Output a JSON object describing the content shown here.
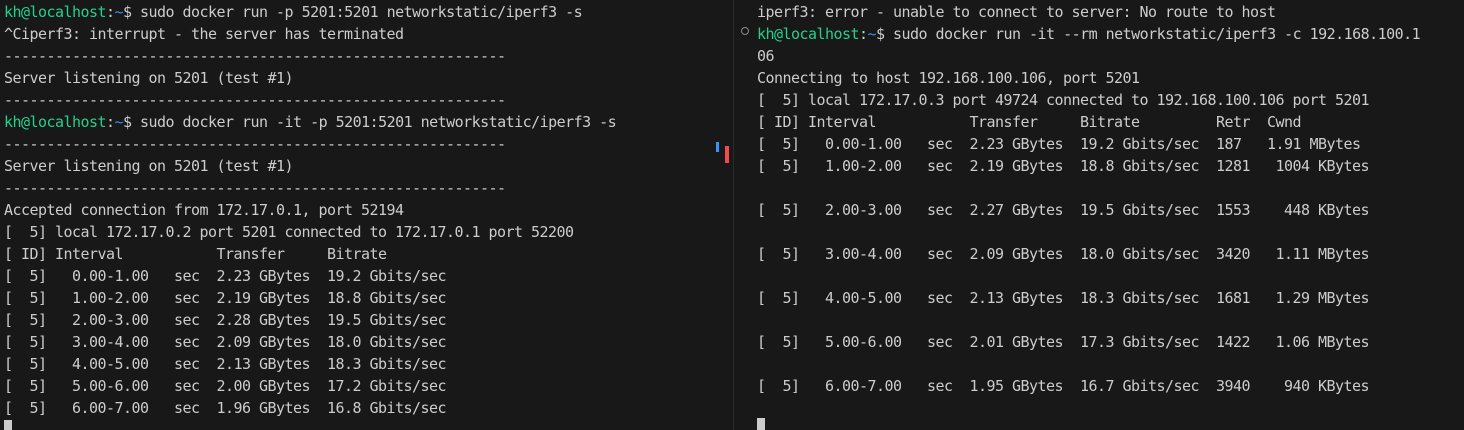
{
  "left_terminal": {
    "lines": [
      {
        "user": "kh@localhost",
        "sep": ":",
        "path": "~",
        "rest": "$ sudo docker run -p 5201:5201 networkstatic/iperf3 -s"
      },
      {
        "text": "^Ciperf3: interrupt - the server has terminated"
      },
      {
        "text": "-----------------------------------------------------------"
      },
      {
        "text": "Server listening on 5201 (test #1)"
      },
      {
        "text": "-----------------------------------------------------------"
      },
      {
        "user": "kh@localhost",
        "sep": ":",
        "path": "~",
        "rest": "$ sudo docker run -it -p 5201:5201 networkstatic/iperf3 -s"
      },
      {
        "text": "-----------------------------------------------------------"
      },
      {
        "text": "Server listening on 5201 (test #1)"
      },
      {
        "text": "-----------------------------------------------------------"
      },
      {
        "text": "Accepted connection from 172.17.0.1, port 52194"
      },
      {
        "text": "[  5] local 172.17.0.2 port 5201 connected to 172.17.0.1 port 52200"
      },
      {
        "text": "[ ID] Interval           Transfer     Bitrate"
      },
      {
        "text": "[  5]   0.00-1.00   sec  2.23 GBytes  19.2 Gbits/sec"
      },
      {
        "text": "[  5]   1.00-2.00   sec  2.19 GBytes  18.8 Gbits/sec"
      },
      {
        "text": "[  5]   2.00-3.00   sec  2.28 GBytes  19.5 Gbits/sec"
      },
      {
        "text": "[  5]   3.00-4.00   sec  2.09 GBytes  18.0 Gbits/sec"
      },
      {
        "text": "[  5]   4.00-5.00   sec  2.13 GBytes  18.3 Gbits/sec"
      },
      {
        "text": "[  5]   5.00-6.00   sec  2.00 GBytes  17.2 Gbits/sec"
      },
      {
        "text": "[  5]   6.00-7.00   sec  1.96 GBytes  16.8 Gbits/sec"
      }
    ]
  },
  "right_terminal": {
    "lines": [
      {
        "text": "iperf3: error - unable to connect to server: No route to host"
      },
      {
        "user": "kh@localhost",
        "sep": ":",
        "path": "~",
        "rest": "$ sudo docker run -it --rm networkstatic/iperf3 -c 192.168.100.1"
      },
      {
        "text": "06"
      },
      {
        "text": "Connecting to host 192.168.100.106, port 5201"
      },
      {
        "text": "[  5] local 172.17.0.3 port 49724 connected to 192.168.100.106 port 5201"
      },
      {
        "text": "[ ID] Interval           Transfer     Bitrate         Retr  Cwnd"
      },
      {
        "text": "[  5]   0.00-1.00   sec  2.23 GBytes  19.2 Gbits/sec  187   1.91 MBytes"
      },
      {
        "text": "[  5]   1.00-2.00   sec  2.19 GBytes  18.8 Gbits/sec  1281   1004 KBytes"
      },
      {
        "text": ""
      },
      {
        "text": "[  5]   2.00-3.00   sec  2.27 GBytes  19.5 Gbits/sec  1553    448 KBytes"
      },
      {
        "text": ""
      },
      {
        "text": "[  5]   3.00-4.00   sec  2.09 GBytes  18.0 Gbits/sec  3420   1.11 MBytes"
      },
      {
        "text": ""
      },
      {
        "text": "[  5]   4.00-5.00   sec  2.13 GBytes  18.3 Gbits/sec  1681   1.29 MBytes"
      },
      {
        "text": ""
      },
      {
        "text": "[  5]   5.00-6.00   sec  2.01 GBytes  17.3 Gbits/sec  1422   1.06 MBytes"
      },
      {
        "text": ""
      },
      {
        "text": "[  5]   6.00-7.00   sec  1.95 GBytes  16.7 Gbits/sec  3940    940 KBytes"
      }
    ]
  },
  "colors": {
    "background": "#181818",
    "text": "#cccccc",
    "prompt_user": "#23d18b",
    "prompt_path": "#3b8eea"
  }
}
